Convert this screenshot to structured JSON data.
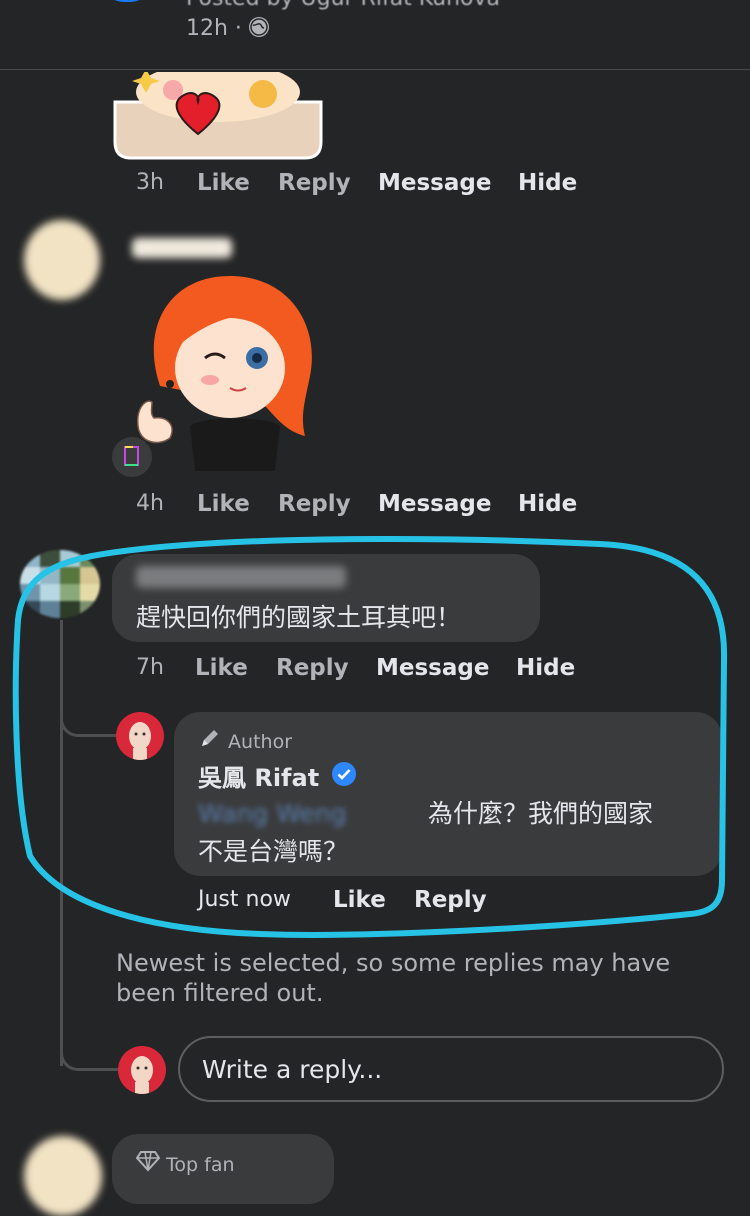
{
  "post": {
    "posted_by": "Posted by Ugur Rifat Kuhova",
    "time": "12h",
    "globe_icon": "globe-icon"
  },
  "comment1": {
    "time": "3h",
    "actions": [
      "Like",
      "Reply",
      "Message",
      "Hide"
    ]
  },
  "comment2": {
    "time": "4h",
    "actions": [
      "Like",
      "Reply",
      "Message",
      "Hide"
    ]
  },
  "comment3": {
    "text": "趕快回你們的國家土耳其吧！",
    "time": "7h",
    "actions": [
      "Like",
      "Reply",
      "Message",
      "Hide"
    ]
  },
  "reply": {
    "badge": "Author",
    "name": "吳鳳 Rifat",
    "mention": "Wang Weng",
    "text_line1": "為什麼？我們的國家",
    "text_line2": "不是台灣嗎？",
    "time": "Just now",
    "actions": [
      "Like",
      "Reply"
    ]
  },
  "filter_notice": {
    "line1": "Newest is selected, so some replies may have",
    "line2": "been filtered out."
  },
  "reply_input": {
    "placeholder": "Write a reply..."
  },
  "next_comment": {
    "badge": "Top fan"
  },
  "colors": {
    "background": "#242526",
    "bubble": "#3a3b3c",
    "highlight": "#27c3e6",
    "verified": "#2d88ff"
  }
}
